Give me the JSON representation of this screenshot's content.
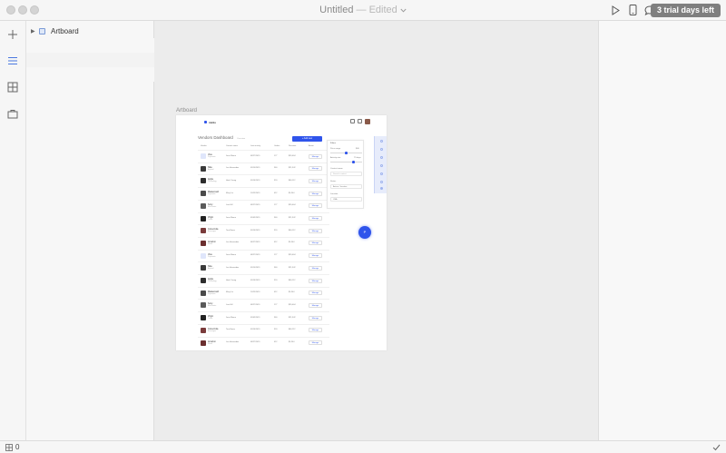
{
  "window": {
    "title": "Untitled",
    "title_separator": "—",
    "edited_label": "Edited",
    "trial_label": "3 trial days left"
  },
  "colors": {
    "accent": "#2f54eb",
    "trial_button": "#7f7f7f",
    "canvas": "#ececec"
  },
  "toolbar_icons": [
    "play-icon",
    "device-preview-icon",
    "comment-icon",
    "chevron-down-icon"
  ],
  "rail": {
    "items": [
      {
        "name": "add-icon",
        "active": false
      },
      {
        "name": "layers-list-icon",
        "active": true
      },
      {
        "name": "components-grid-icon",
        "active": false
      },
      {
        "name": "assets-briefcase-icon",
        "active": false
      }
    ]
  },
  "layers": {
    "items": [
      {
        "label": "Artboard",
        "expanded": false
      }
    ]
  },
  "canvas": {
    "artboard_label": "Artboard",
    "artboard": {
      "brand": "minlo",
      "heading": "Vendors Dashboard",
      "heading_sub": "Overview",
      "cta_label": "+ Add new",
      "table_headers": [
        "Vendor",
        "Contact name",
        "Last activity",
        "Orders",
        "Revenue",
        "Action"
      ],
      "rows": [
        {
          "name": "Visa",
          "sub": "Payments",
          "contact": "Jane Moore",
          "date": "08/27/2019",
          "orders": "177",
          "revenue": "$35,464",
          "thumb": "#dfe6fb"
        },
        {
          "name": "Nike",
          "sub": "Apparel",
          "contact": "Leo Hernandez",
          "date": "09/10/2019",
          "orders": "360",
          "revenue": "$21,342",
          "thumb": "#3a3a3a"
        },
        {
          "name": "Apple",
          "sub": "Technology",
          "contact": "Hank Young",
          "date": "09/16/2019",
          "orders": "320",
          "revenue": "$46,112",
          "thumb": "#2d2d2d"
        },
        {
          "name": "Mastercard",
          "sub": "Payments",
          "contact": "Mary Liu",
          "date": "10/25/2019",
          "orders": "412",
          "revenue": "$9,244",
          "thumb": "#4a4a4a"
        },
        {
          "name": "Sony",
          "sub": "Electronics",
          "contact": "Liza Hill",
          "date": "08/27/2019",
          "orders": "177",
          "revenue": "$35,464",
          "thumb": "#5a5a5a"
        },
        {
          "name": "Virgin",
          "sub": "Travel",
          "contact": "Jane Moore",
          "date": "09/05/2019",
          "orders": "360",
          "revenue": "$21,342",
          "thumb": "#222222"
        },
        {
          "name": "Coca-Cola",
          "sub": "Beverages",
          "contact": "Tom Bauer",
          "date": "09/16/2019",
          "orders": "320",
          "revenue": "$46,112",
          "thumb": "#7a3b3b"
        },
        {
          "name": "Amazon",
          "sub": "Retail",
          "contact": "Leo Hernandez",
          "date": "08/27/2019",
          "orders": "412",
          "revenue": "$9,244",
          "thumb": "#6b2f2f"
        },
        {
          "name": "Visa",
          "sub": "Payments",
          "contact": "Jane Moore",
          "date": "08/27/2019",
          "orders": "177",
          "revenue": "$35,464",
          "thumb": "#dfe6fb"
        },
        {
          "name": "Nike",
          "sub": "Apparel",
          "contact": "Leo Hernandez",
          "date": "09/10/2019",
          "orders": "360",
          "revenue": "$21,342",
          "thumb": "#3a3a3a"
        },
        {
          "name": "Apple",
          "sub": "Technology",
          "contact": "Hank Young",
          "date": "09/16/2019",
          "orders": "320",
          "revenue": "$46,112",
          "thumb": "#2d2d2d"
        },
        {
          "name": "Mastercard",
          "sub": "Payments",
          "contact": "Mary Liu",
          "date": "10/25/2019",
          "orders": "412",
          "revenue": "$9,244",
          "thumb": "#4a4a4a"
        },
        {
          "name": "Sony",
          "sub": "Electronics",
          "contact": "Liza Hill",
          "date": "08/27/2019",
          "orders": "177",
          "revenue": "$35,464",
          "thumb": "#5a5a5a"
        },
        {
          "name": "Virgin",
          "sub": "Travel",
          "contact": "Jane Moore",
          "date": "09/05/2019",
          "orders": "360",
          "revenue": "$21,342",
          "thumb": "#222222"
        },
        {
          "name": "Coca-Cola",
          "sub": "Beverages",
          "contact": "Tom Bauer",
          "date": "09/16/2019",
          "orders": "320",
          "revenue": "$46,112",
          "thumb": "#7a3b3b"
        },
        {
          "name": "Amazon",
          "sub": "Retail",
          "contact": "Leo Hernandez",
          "date": "08/27/2019",
          "orders": "412",
          "revenue": "$9,244",
          "thumb": "#6b2f2f"
        }
      ],
      "manage_label": "Manage",
      "filter_panel": {
        "title": "Filters",
        "range_label": "Price range",
        "range_value": "$40",
        "activity_label": "Activity rate",
        "activity_value": "75 days",
        "contact_label": "Contact name",
        "contact_placeholder": "Search contact",
        "status_label": "Status",
        "status_value": "Active / Inactive",
        "location_label": "Location",
        "location_value": "USA"
      },
      "fab_label": "P"
    }
  },
  "status": {
    "count": "0"
  }
}
